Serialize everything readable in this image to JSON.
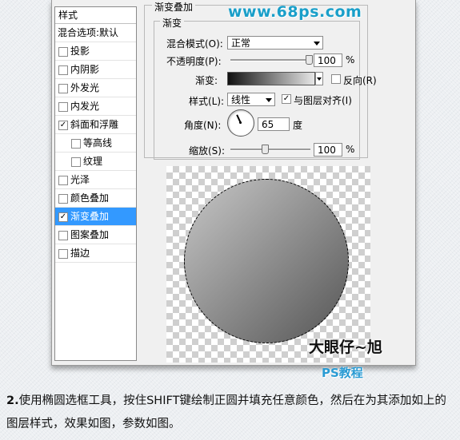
{
  "watermark": "www.68ps.com",
  "styles_panel": {
    "header": "样式",
    "blend_options": "混合选项:默认",
    "items": [
      {
        "label": "投影",
        "checked": false,
        "indent": false,
        "selected": false
      },
      {
        "label": "内阴影",
        "checked": false,
        "indent": false,
        "selected": false
      },
      {
        "label": "外发光",
        "checked": false,
        "indent": false,
        "selected": false
      },
      {
        "label": "内发光",
        "checked": false,
        "indent": false,
        "selected": false
      },
      {
        "label": "斜面和浮雕",
        "checked": true,
        "indent": false,
        "selected": false
      },
      {
        "label": "等高线",
        "checked": false,
        "indent": true,
        "selected": false
      },
      {
        "label": "纹理",
        "checked": false,
        "indent": true,
        "selected": false
      },
      {
        "label": "光泽",
        "checked": false,
        "indent": false,
        "selected": false
      },
      {
        "label": "颜色叠加",
        "checked": false,
        "indent": false,
        "selected": false
      },
      {
        "label": "渐变叠加",
        "checked": true,
        "indent": false,
        "selected": true
      },
      {
        "label": "图案叠加",
        "checked": false,
        "indent": false,
        "selected": false
      },
      {
        "label": "描边",
        "checked": false,
        "indent": false,
        "selected": false
      }
    ]
  },
  "gradient_overlay": {
    "title": "渐变叠加",
    "subtitle": "渐变",
    "blend_mode_label": "混合模式(O):",
    "blend_mode_value": "正常",
    "opacity_label": "不透明度(P):",
    "opacity_value": "100",
    "opacity_unit": "%",
    "opacity_level": 1.0,
    "gradient_label": "渐变:",
    "reverse_label": "反向(R)",
    "reverse_checked": false,
    "style_label": "样式(L):",
    "style_value": "线性",
    "align_label": "与图层对齐(I)",
    "align_checked": true,
    "angle_label": "角度(N):",
    "angle_value": "65",
    "angle_unit": "度",
    "scale_label": "缩放(S):",
    "scale_value": "100",
    "scale_unit": "%",
    "scale_level": 0.42,
    "gradient_colors": [
      "#111111",
      "#888888",
      "#e6e6e6"
    ]
  },
  "brand": {
    "line1": "大眼仔~旭",
    "line2": "PS教程"
  },
  "caption": {
    "number": "2.",
    "text": "使用椭圆选框工具，按住SHIFT键绘制正圆并填充任意颜色，然后在为其添加如上的图层样式，效果如图，参数如图。"
  }
}
